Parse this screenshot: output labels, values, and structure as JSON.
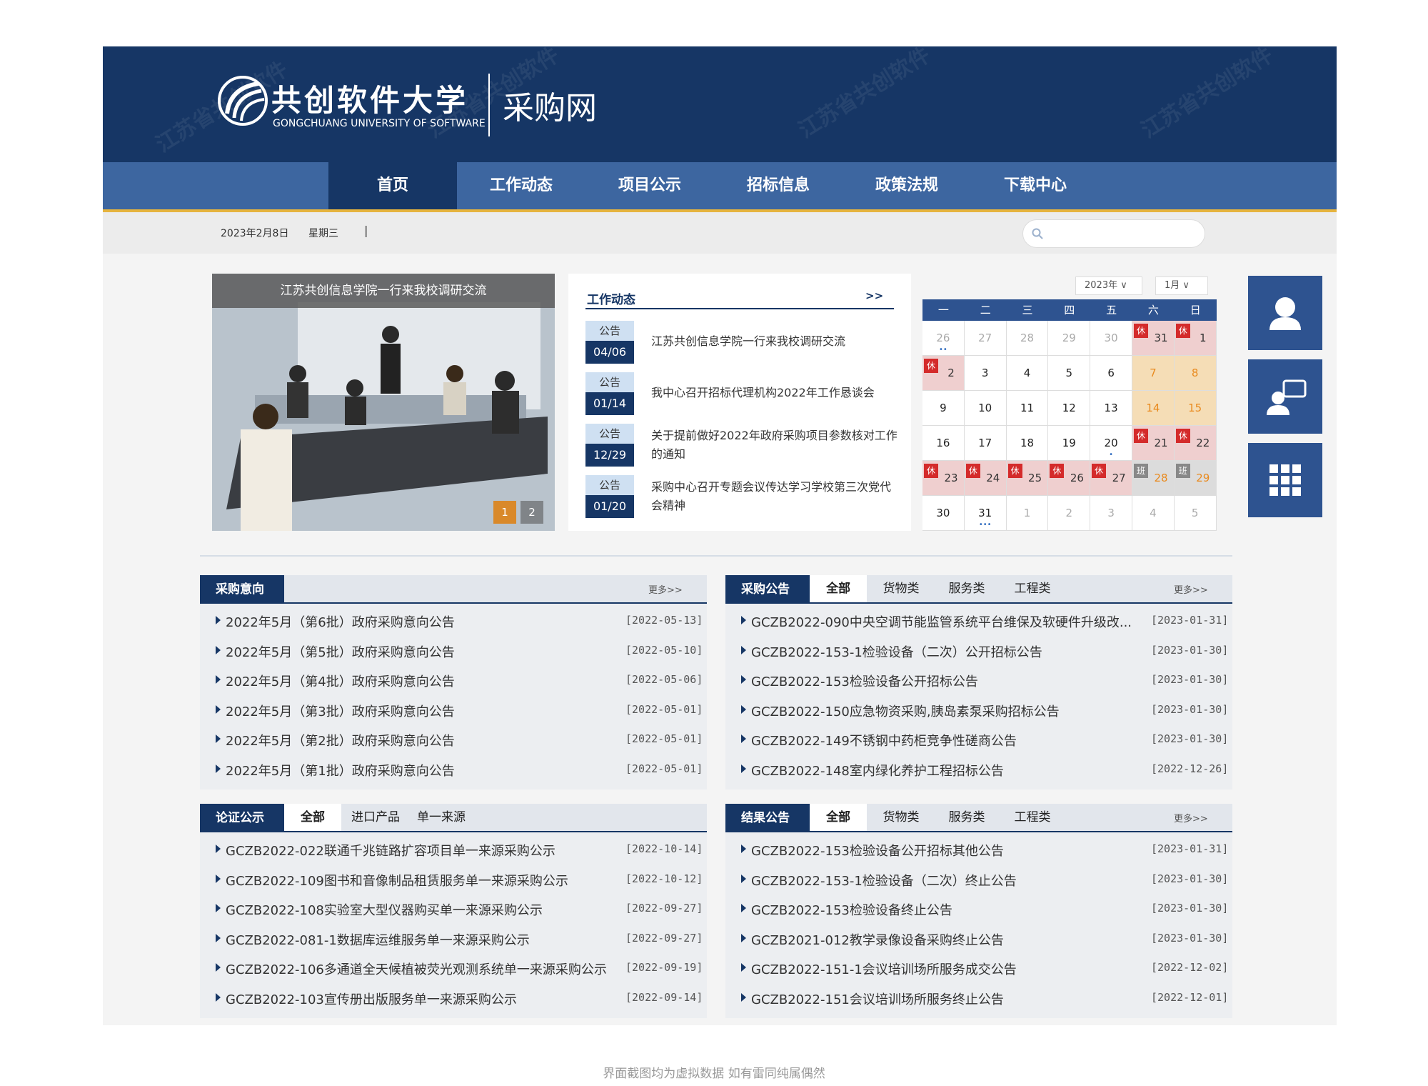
{
  "header": {
    "uni_name": "共创软件大学",
    "uni_name_en": "GONGCHUANG UNIVERSITY OF SOFTWARE",
    "site_name": "采购网"
  },
  "nav": [
    {
      "label": "首页",
      "active": true
    },
    {
      "label": "工作动态"
    },
    {
      "label": "项目公示"
    },
    {
      "label": "招标信息"
    },
    {
      "label": "政策法规"
    },
    {
      "label": "下载中心"
    }
  ],
  "infobar": {
    "date": "2023年2月8日",
    "weekday": "星期三",
    "sep": "|",
    "search_placeholder": ""
  },
  "slideshow": {
    "caption": "江苏共创信息学院一行来我校调研交流",
    "pages": [
      "1",
      "2"
    ],
    "active_page": "1"
  },
  "news": {
    "title": "工作动态",
    "more": ">>",
    "items": [
      {
        "tag": "公告",
        "date": "04/06",
        "text": "江苏共创信息学院一行来我校调研交流"
      },
      {
        "tag": "公告",
        "date": "01/14",
        "text": "我中心召开招标代理机构2022年工作恳谈会"
      },
      {
        "tag": "公告",
        "date": "12/29",
        "text": "关于提前做好2022年政府采购项目参数核对工作的通知"
      },
      {
        "tag": "公告",
        "date": "01/20",
        "text": "采购中心召开专题会议传达学习学校第三次党代会精神"
      }
    ]
  },
  "calendar": {
    "year": "2023年",
    "month": "1月",
    "weekdays": [
      "一",
      "二",
      "三",
      "四",
      "五",
      "六",
      "日"
    ],
    "weeks": [
      [
        {
          "d": "26",
          "o": 1,
          "dots": "••"
        },
        {
          "d": "27",
          "o": 1
        },
        {
          "d": "28",
          "o": 1
        },
        {
          "d": "29",
          "o": 1
        },
        {
          "d": "30",
          "o": 1
        },
        {
          "d": "31",
          "o": 1,
          "b": "休",
          "s": "rest"
        },
        {
          "d": "1",
          "b": "休",
          "s": "rest"
        }
      ],
      [
        {
          "d": "2",
          "b": "休",
          "s": "rest"
        },
        {
          "d": "3"
        },
        {
          "d": "4"
        },
        {
          "d": "5"
        },
        {
          "d": "6"
        },
        {
          "d": "7",
          "s": "wkd"
        },
        {
          "d": "8",
          "s": "wkd"
        }
      ],
      [
        {
          "d": "9"
        },
        {
          "d": "10"
        },
        {
          "d": "11"
        },
        {
          "d": "12"
        },
        {
          "d": "13"
        },
        {
          "d": "14",
          "s": "wkd"
        },
        {
          "d": "15",
          "s": "wkd"
        }
      ],
      [
        {
          "d": "16"
        },
        {
          "d": "17"
        },
        {
          "d": "18"
        },
        {
          "d": "19"
        },
        {
          "d": "20",
          "dots": "•"
        },
        {
          "d": "21",
          "b": "休",
          "s": "rest"
        },
        {
          "d": "22",
          "b": "休",
          "s": "rest"
        }
      ],
      [
        {
          "d": "23",
          "b": "休",
          "s": "rest"
        },
        {
          "d": "24",
          "b": "休",
          "s": "rest"
        },
        {
          "d": "25",
          "b": "休",
          "s": "rest"
        },
        {
          "d": "26",
          "b": "休",
          "s": "rest"
        },
        {
          "d": "27",
          "b": "休",
          "s": "rest"
        },
        {
          "d": "28",
          "b": "班",
          "s": "work"
        },
        {
          "d": "29",
          "b": "班",
          "s": "work"
        }
      ],
      [
        {
          "d": "30"
        },
        {
          "d": "31",
          "dots": "•••"
        },
        {
          "d": "1",
          "o": 1
        },
        {
          "d": "2",
          "o": 1
        },
        {
          "d": "3",
          "o": 1
        },
        {
          "d": "4",
          "o": 1
        },
        {
          "d": "5",
          "o": 1
        }
      ]
    ]
  },
  "sections": {
    "intent": {
      "title": "采购意向",
      "more": "更多>>",
      "tabs": [],
      "rows": [
        {
          "t": "2022年5月（第6批）政府采购意向公告",
          "d": "[2022-05-13]"
        },
        {
          "t": "2022年5月（第5批）政府采购意向公告",
          "d": "[2022-05-10]"
        },
        {
          "t": "2022年5月（第4批）政府采购意向公告",
          "d": "[2022-05-06]"
        },
        {
          "t": "2022年5月（第3批）政府采购意向公告",
          "d": "[2022-05-01]"
        },
        {
          "t": "2022年5月（第2批）政府采购意向公告",
          "d": "[2022-05-01]"
        },
        {
          "t": "2022年5月（第1批）政府采购意向公告",
          "d": "[2022-05-01]"
        }
      ]
    },
    "announce": {
      "title": "采购公告",
      "more": "更多>>",
      "tabs": [
        "全部",
        "货物类",
        "服务类",
        "工程类"
      ],
      "rows": [
        {
          "t": "GCZB2022-090中央空调节能监管系统平台维保及软硬件升级改...",
          "d": "[2023-01-31]"
        },
        {
          "t": "GCZB2022-153-1检验设备（二次）公开招标公告",
          "d": "[2023-01-30]"
        },
        {
          "t": "GCZB2022-153检验设备公开招标公告",
          "d": "[2023-01-30]"
        },
        {
          "t": "GCZB2022-150应急物资采购,胰岛素泵采购招标公告",
          "d": "[2023-01-30]"
        },
        {
          "t": "GCZB2022-149不锈钢中药柜竞争性磋商公告",
          "d": "[2023-01-30]"
        },
        {
          "t": "GCZB2022-148室内绿化养护工程招标公告",
          "d": "[2022-12-26]"
        }
      ]
    },
    "proof": {
      "title": "论证公示",
      "more": "",
      "tabs": [
        "全部",
        "进口产品",
        "单一来源"
      ],
      "rows": [
        {
          "t": "GCZB2022-022联通千兆链路扩容项目单一来源采购公示",
          "d": "[2022-10-14]"
        },
        {
          "t": "GCZB2022-109图书和音像制品租赁服务单一来源采购公示",
          "d": "[2022-10-12]"
        },
        {
          "t": "GCZB2022-108实验室大型仪器购买单一来源采购公示",
          "d": "[2022-09-27]"
        },
        {
          "t": "GCZB2022-081-1数据库运维服务单一来源采购公示",
          "d": "[2022-09-27]"
        },
        {
          "t": "GCZB2022-106多通道全天候植被荧光观测系统单一来源采购公示",
          "d": "[2022-09-19]"
        },
        {
          "t": "GCZB2022-103宣传册出版服务单一来源采购公示",
          "d": "[2022-09-14]"
        }
      ]
    },
    "result": {
      "title": "结果公告",
      "more": "更多>>",
      "tabs": [
        "全部",
        "货物类",
        "服务类",
        "工程类"
      ],
      "rows": [
        {
          "t": "GCZB2022-153检验设备公开招标其他公告",
          "d": "[2023-01-31]"
        },
        {
          "t": "GCZB2022-153-1检验设备（二次）终止公告",
          "d": "[2023-01-30]"
        },
        {
          "t": "GCZB2022-153检验设备终止公告",
          "d": "[2023-01-30]"
        },
        {
          "t": "GCZB2021-012教学录像设备采购终止公告",
          "d": "[2023-01-30]"
        },
        {
          "t": "GCZB2022-151-1会议培训场所服务成交公告",
          "d": "[2022-12-02]"
        },
        {
          "t": "GCZB2022-151会议培训场所服务终止公告",
          "d": "[2022-12-01]"
        }
      ]
    }
  },
  "footer_note": "界面截图均为虚拟数据 如有雷同纯属偶然",
  "colors": {
    "primary": "#163665",
    "nav": "#3d66a0",
    "accent": "#e6b43e",
    "rest": "#d42b2b"
  }
}
